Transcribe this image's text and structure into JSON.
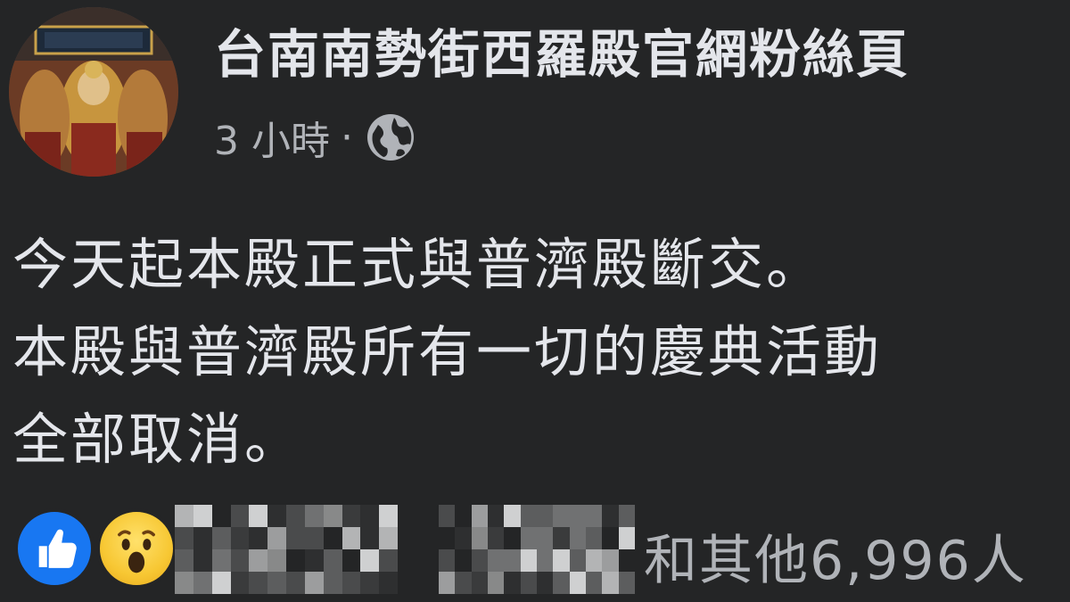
{
  "header": {
    "page_name": "台南南勢街西羅殿官網粉絲頁",
    "time_ago": "3 小時",
    "separator": "·",
    "privacy_icon": "globe-icon"
  },
  "post": {
    "lines": [
      "今天起本殿正式與普濟殿斷交。",
      "本殿與普濟殿所有一切的慶典活動",
      "全部取消。"
    ]
  },
  "reactions": {
    "icons": [
      "like-icon",
      "wow-icon"
    ],
    "names_blurred": true,
    "summary": "和其他6,996人"
  },
  "colors": {
    "background": "#242526",
    "text_primary": "#e4e6eb",
    "text_secondary": "#b0b3b8",
    "like_blue": "#1877f2",
    "wow_yellow": "#f7c733"
  }
}
